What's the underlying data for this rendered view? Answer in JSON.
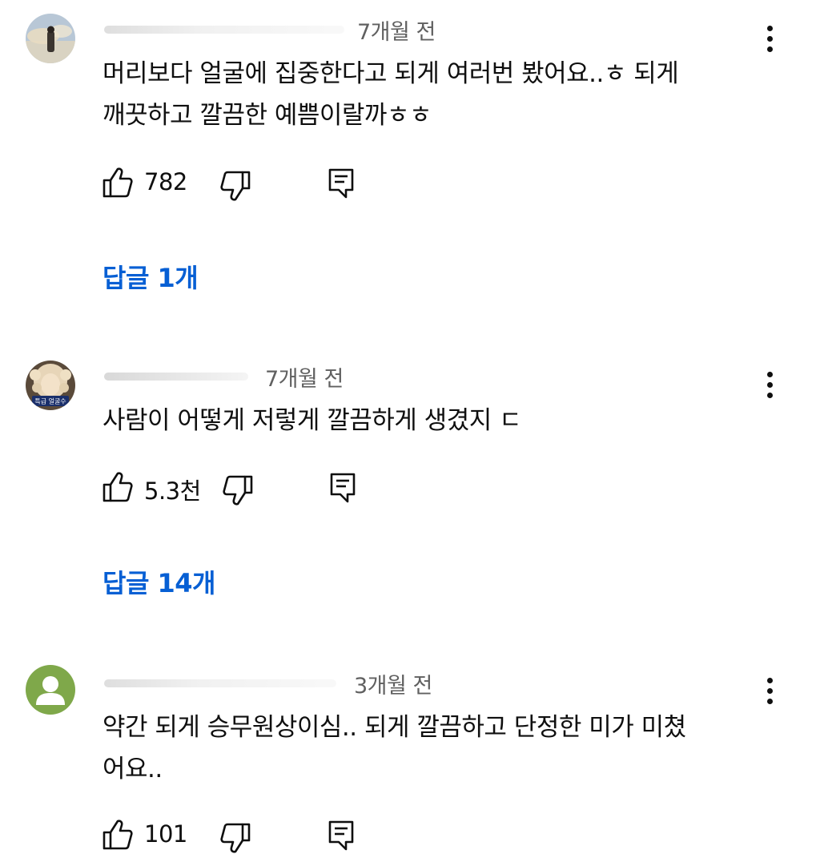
{
  "comments": [
    {
      "timestamp": "7개월 전",
      "text": "머리보다 얼굴에 집중한다고 되게 여러번 봤어요..ㅎ 되게\n깨끗하고 깔끔한 예쁨이랄까ㅎㅎ",
      "like_count": "782",
      "replies_label": "답글 1개"
    },
    {
      "timestamp": "7개월 전",
      "avatar_caption": "특급 얼굴수",
      "text": "사람이 어떻게 저렇게 깔끔하게 생겼지 ㄷ",
      "like_count": "5.3천",
      "replies_label": "답글 14개"
    },
    {
      "timestamp": "3개월 전",
      "text": "약간 되게 승무원상이심.. 되게 깔끔하고 단정한 미가 미쳤\n어요..",
      "like_count": "101"
    }
  ],
  "icons": {
    "like": "thumbs-up-icon",
    "dislike": "thumbs-down-icon",
    "reply": "comment-reply-icon",
    "more": "more-vertical-icon"
  },
  "colors": {
    "reply_link": "#065fd4",
    "secondary_text": "#606060",
    "primary_text": "#0f0f0f",
    "default_avatar": "#7fa84a"
  }
}
